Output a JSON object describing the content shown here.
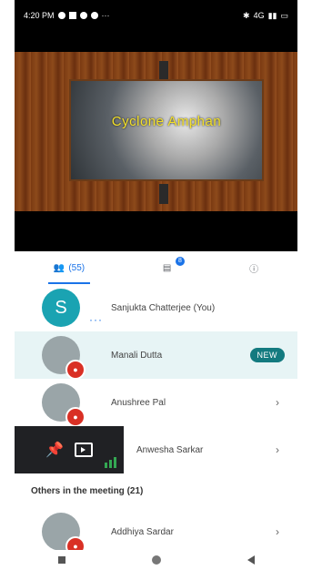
{
  "status_bar": {
    "time": "4:20 PM",
    "network": "4G"
  },
  "presentation": {
    "slide_title": "Cyclone Amphan"
  },
  "tabs": [
    {
      "label": "(55)",
      "icon": "people-icon"
    },
    {
      "label": "",
      "icon": "chat-icon",
      "badge": "8"
    },
    {
      "label": "",
      "icon": "info-icon"
    }
  ],
  "participants": [
    {
      "name": "Sanjukta Chatterjee (You)",
      "initial": "S"
    },
    {
      "name": "Manali Dutta",
      "tag": "NEW"
    },
    {
      "name": "Anushree Pal"
    },
    {
      "name": "Anwesha Sarkar"
    }
  ],
  "others_section": {
    "title": "Others in the meeting (21)"
  },
  "others": [
    {
      "name": "Addhiya Sardar"
    }
  ]
}
